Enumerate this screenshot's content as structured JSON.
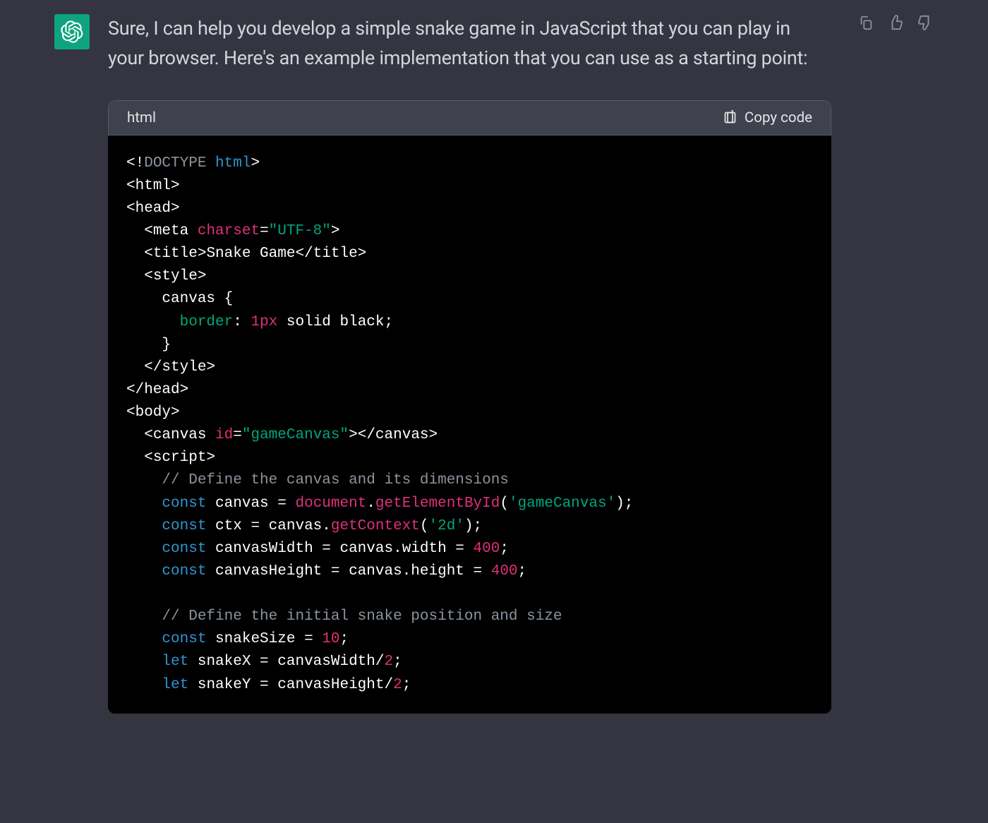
{
  "response_text": "Sure, I can help you develop a simple snake game in JavaScript that you can play in your browser. Here's an example implementation that you can use as a starting point:",
  "code_block": {
    "language": "html",
    "copy_label": "Copy code"
  },
  "tokens": {
    "doctype_open": "<!",
    "doctype_word": "DOCTYPE",
    "html_kw": "html",
    "doctype_close": ">",
    "html_open": "<html>",
    "head_open": "<head>",
    "meta_open": "<meta",
    "charset_attr": "charset",
    "eq": "=",
    "charset_val": "\"UTF-8\"",
    "meta_close": ">",
    "title_open": "<title>",
    "title_text": "Snake Game",
    "title_close": "</title>",
    "style_open": "<style>",
    "css_sel": "canvas {",
    "css_border_prop": "border",
    "css_colon": ":",
    "css_border_num": "1px",
    "css_border_rest": "solid black;",
    "css_close": "}",
    "style_close": "</style>",
    "head_close": "</head>",
    "body_open": "<body>",
    "canvas_open": "<canvas",
    "id_attr": "id",
    "id_val": "\"gameCanvas\"",
    "canvas_closeopen": ">",
    "canvas_close": "</canvas>",
    "script_open": "<script>",
    "comment1": "// Define the canvas and its dimensions",
    "const_kw": "const",
    "let_kw": "let",
    "canvas_var": "canvas =",
    "document_obj": "document",
    "dot": ".",
    "getElById": "getElementById",
    "open_paren": "(",
    "gameCanvas_str": "'gameCanvas'",
    "close_paren_semi": ");",
    "ctx_var": "ctx = canvas.",
    "getContext": "getContext",
    "twod_str": "'2d'",
    "cw_var": "canvasWidth = canvas.width =",
    "num400": "400",
    "semi": ";",
    "ch_var": "canvasHeight = canvas.height =",
    "comment2": "// Define the initial snake position and size",
    "snakeSize_var": "snakeSize =",
    "num10": "10",
    "snakeX_var": "snakeX = canvasWidth/",
    "num2": "2",
    "snakeY_var": "snakeY = canvasHeight/"
  }
}
